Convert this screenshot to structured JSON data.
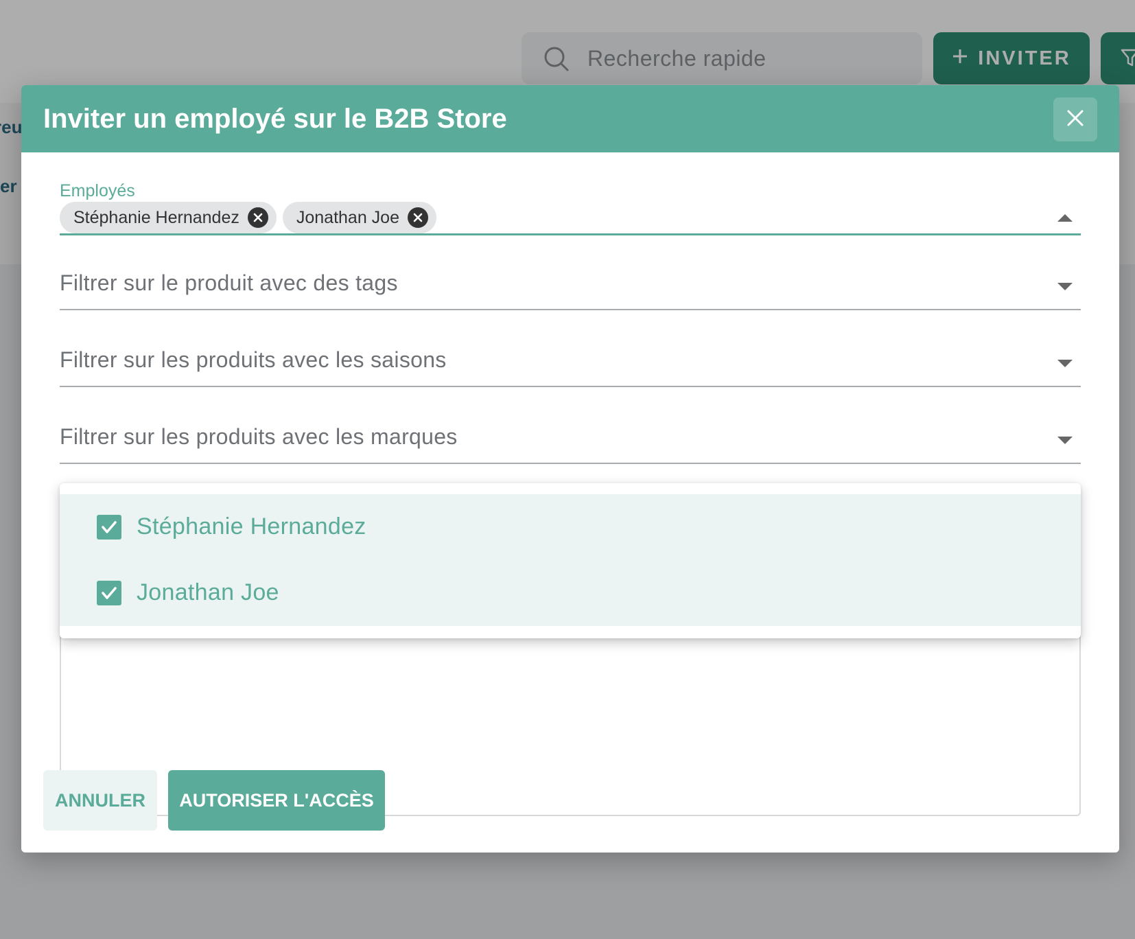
{
  "background": {
    "search": {
      "placeholder": "Recherche rapide"
    },
    "invite_button": {
      "label": "INVITER"
    },
    "fragments": [
      "reu",
      "er"
    ]
  },
  "dialog": {
    "title": "Inviter un employé sur le B2B Store",
    "employees_field": {
      "label": "Employés",
      "chips": [
        "Stéphanie Hernandez",
        "Jonathan Joe"
      ]
    },
    "tags_select": {
      "placeholder": "Filtrer sur le produit avec des tags"
    },
    "seasons_select": {
      "placeholder": "Filtrer sur les produits avec les saisons"
    },
    "brands_select": {
      "placeholder": "Filtrer sur les produits avec les marques"
    },
    "dropdown_options": [
      {
        "label": "Stéphanie Hernandez",
        "checked": true
      },
      {
        "label": "Jonathan Joe",
        "checked": true
      }
    ],
    "cancel_label": "ANNULER",
    "confirm_label": "AUTORISER L'ACCÈS"
  },
  "colors": {
    "primary": "#5aab99",
    "primary_dark": "#2f8c73",
    "selected_bg": "#ebf4f2"
  },
  "icons": [
    "search-icon",
    "plus-icon",
    "filter-icon",
    "close-icon",
    "chip-remove-icon",
    "caret-up-icon",
    "caret-down-icon",
    "checkbox-checked-icon"
  ]
}
